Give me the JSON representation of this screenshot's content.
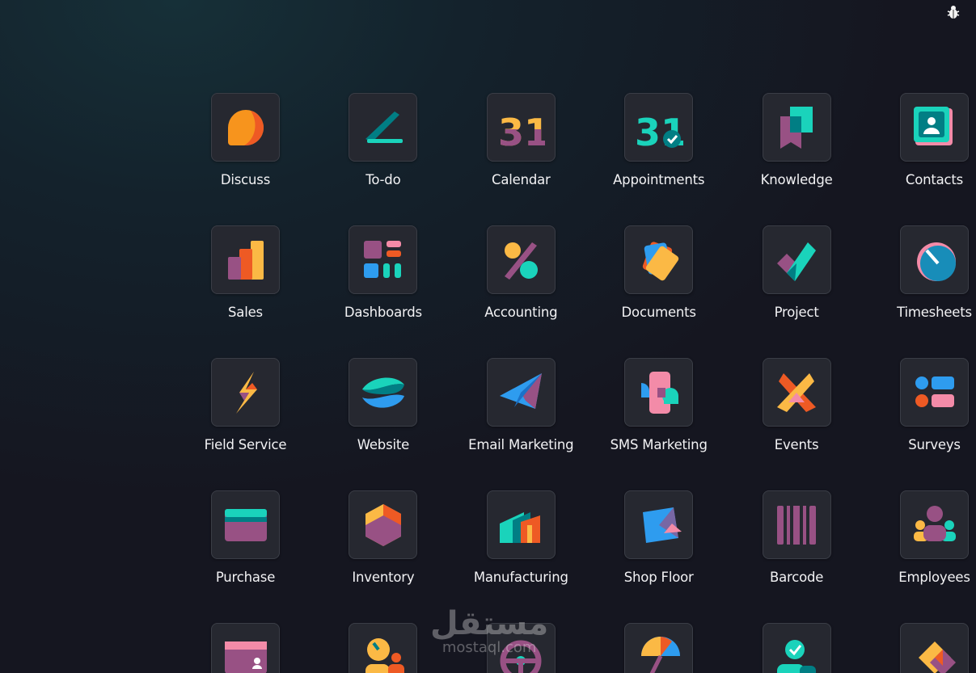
{
  "topbar": {
    "debug_icon": "bug-icon"
  },
  "apps": [
    {
      "name": "Discuss",
      "icon": "discuss-icon"
    },
    {
      "name": "To-do",
      "icon": "todo-icon"
    },
    {
      "name": "Calendar",
      "icon": "calendar-icon",
      "icon_text": "31"
    },
    {
      "name": "Appointments",
      "icon": "appointments-icon",
      "icon_text": "31"
    },
    {
      "name": "Knowledge",
      "icon": "knowledge-icon"
    },
    {
      "name": "Contacts",
      "icon": "contacts-icon"
    },
    {
      "name": "Sales",
      "icon": "sales-icon"
    },
    {
      "name": "Dashboards",
      "icon": "dashboards-icon"
    },
    {
      "name": "Accounting",
      "icon": "accounting-icon"
    },
    {
      "name": "Documents",
      "icon": "documents-icon"
    },
    {
      "name": "Project",
      "icon": "project-icon"
    },
    {
      "name": "Timesheets",
      "icon": "timesheets-icon"
    },
    {
      "name": "Field Service",
      "icon": "field-service-icon"
    },
    {
      "name": "Website",
      "icon": "website-icon"
    },
    {
      "name": "Email Marketing",
      "icon": "email-marketing-icon"
    },
    {
      "name": "SMS Marketing",
      "icon": "sms-marketing-icon"
    },
    {
      "name": "Events",
      "icon": "events-icon"
    },
    {
      "name": "Surveys",
      "icon": "surveys-icon"
    },
    {
      "name": "Purchase",
      "icon": "purchase-icon"
    },
    {
      "name": "Inventory",
      "icon": "inventory-icon"
    },
    {
      "name": "Manufacturing",
      "icon": "manufacturing-icon"
    },
    {
      "name": "Shop Floor",
      "icon": "shop-floor-icon"
    },
    {
      "name": "Barcode",
      "icon": "barcode-icon"
    },
    {
      "name": "Employees",
      "icon": "employees-icon"
    },
    {
      "name": "",
      "icon": "payroll-icon"
    },
    {
      "name": "",
      "icon": "recruitment-icon"
    },
    {
      "name": "",
      "icon": "fleet-icon"
    },
    {
      "name": "",
      "icon": "helpdesk-icon"
    },
    {
      "name": "",
      "icon": "appraisals-icon"
    },
    {
      "name": "",
      "icon": "studio-icon"
    }
  ],
  "watermark": {
    "arabic": "مستقل",
    "latin": "mostaql.com"
  }
}
